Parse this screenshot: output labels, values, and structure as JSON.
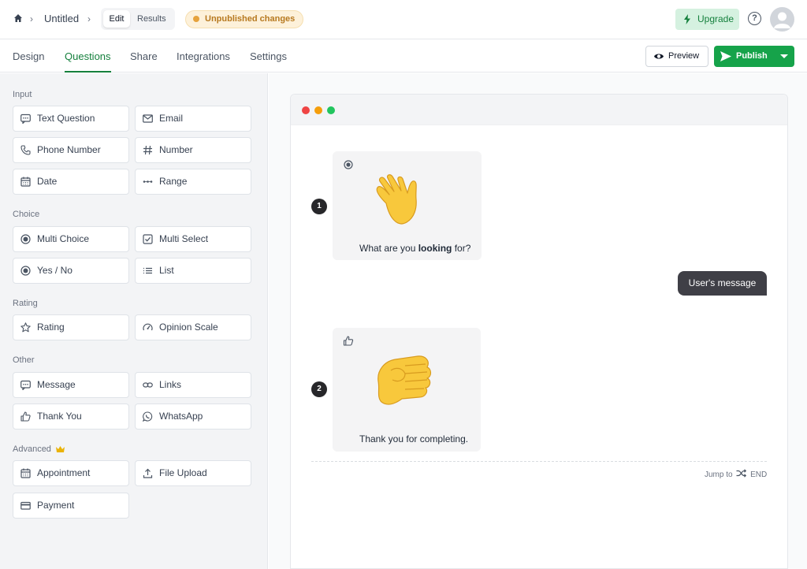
{
  "header": {
    "title": "Untitled",
    "mode_tabs": [
      "Edit",
      "Results"
    ],
    "status_badge": "Unpublished changes",
    "upgrade_label": "Upgrade",
    "help_glyph": "?"
  },
  "tabs": [
    "Design",
    "Questions",
    "Share",
    "Integrations",
    "Settings"
  ],
  "active_tab": "Questions",
  "actions": {
    "preview_label": "Preview",
    "publish_label": "Publish"
  },
  "sidebar": {
    "sections": [
      "Input",
      "Choice",
      "Rating",
      "Other",
      "Advanced"
    ],
    "items": [
      {
        "label": "Text Question",
        "icon": "text-question-icon"
      },
      {
        "label": "Email",
        "icon": "email-icon"
      },
      {
        "label": "Phone Number",
        "icon": "phone-icon"
      },
      {
        "label": "Number",
        "icon": "hash-icon"
      },
      {
        "label": "Date",
        "icon": "calendar-icon"
      },
      {
        "label": "Range",
        "icon": "range-icon"
      },
      {
        "label": "Multi Choice",
        "icon": "radio-icon"
      },
      {
        "label": "Multi Select",
        "icon": "checkbox-icon"
      },
      {
        "label": "Yes / No",
        "icon": "radio-icon"
      },
      {
        "label": "List",
        "icon": "list-icon"
      },
      {
        "label": "Rating",
        "icon": "star-icon"
      },
      {
        "label": "Opinion Scale",
        "icon": "gauge-icon"
      },
      {
        "label": "Message",
        "icon": "message-icon"
      },
      {
        "label": "Links",
        "icon": "link-icon"
      },
      {
        "label": "Thank You",
        "icon": "thumbs-up-icon"
      },
      {
        "label": "WhatsApp",
        "icon": "whatsapp-icon"
      },
      {
        "label": "Appointment",
        "icon": "calendar-icon"
      },
      {
        "label": "File Upload",
        "icon": "upload-icon"
      },
      {
        "label": "Payment",
        "icon": "card-icon"
      }
    ]
  },
  "preview": {
    "questions": [
      {
        "number": "1",
        "text_before": "What are you ",
        "text_bold": "looking",
        "text_after": " for?",
        "emoji": "waving-hand",
        "type_icon": "radio-icon"
      },
      {
        "number": "2",
        "text": "Thank you for completing.",
        "emoji": "fist-bump",
        "type_icon": "thumbs-up-icon"
      }
    ],
    "user_message": "User's message",
    "jump_to": {
      "label": "Jump to",
      "target": "END"
    }
  },
  "colors": {
    "brand_green": "#16a34a",
    "active_tab": "#15803d",
    "badge_bg": "#fdf1da",
    "badge_text": "#b7791f",
    "window_dots": [
      "#ef4444",
      "#f59e0b",
      "#22c55e"
    ],
    "crown": "#eab308"
  }
}
